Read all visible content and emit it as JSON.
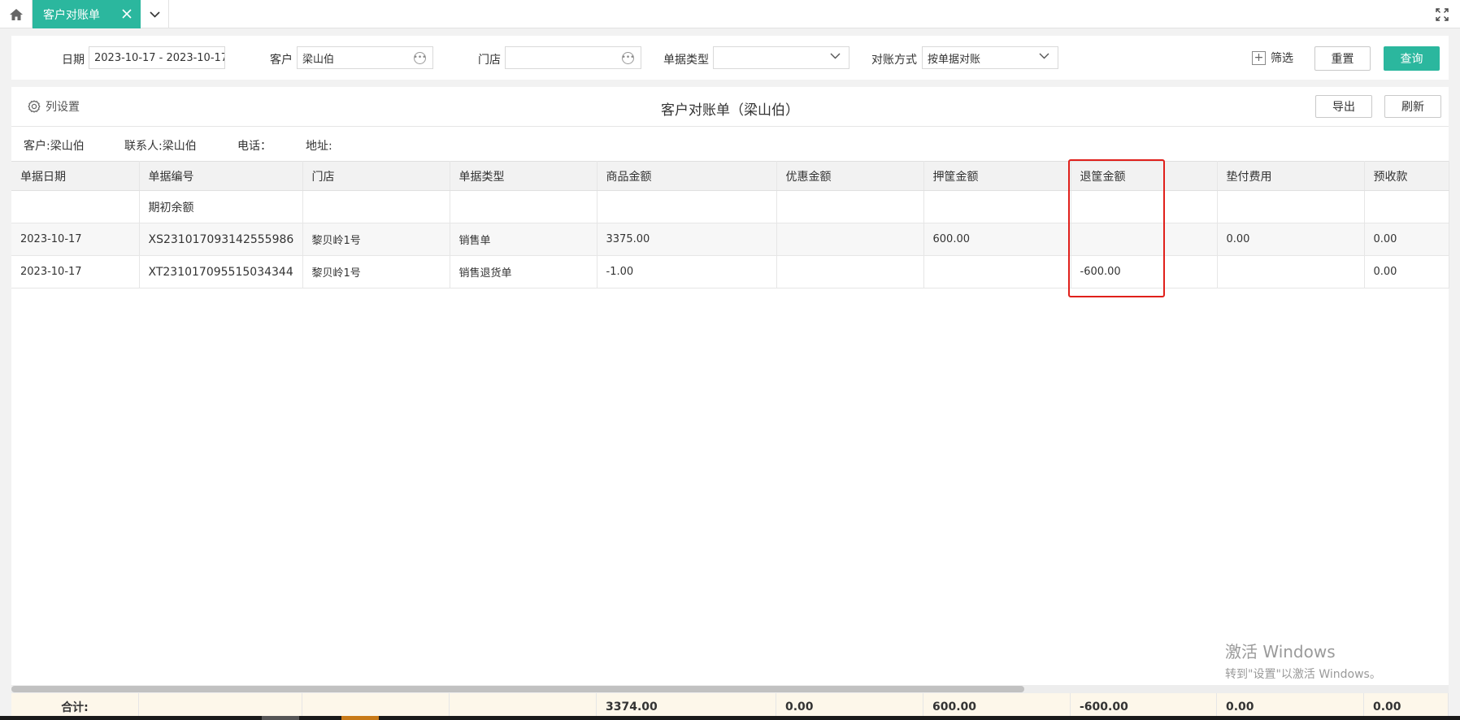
{
  "tabbar": {
    "active_tab": "客户对账单"
  },
  "filters": {
    "date_label": "日期",
    "date_value": "2023-10-17 - 2023-10-17",
    "customer_label": "客户",
    "customer_value": "梁山伯",
    "store_label": "门店",
    "store_value": "",
    "doc_type_label": "单据类型",
    "doc_type_value": "",
    "recon_method_label": "对账方式",
    "recon_method_value": "按单据对账",
    "filter_toggle_label": "筛选",
    "reset_label": "重置",
    "query_label": "查询"
  },
  "report": {
    "column_settings_label": "列设置",
    "title": "客户对账单（梁山伯）",
    "export_label": "导出",
    "refresh_label": "刷新",
    "info": {
      "customer": "客户:梁山伯",
      "contact": "联系人:梁山伯",
      "phone": "电话：",
      "address": "地址:"
    }
  },
  "table": {
    "headers": [
      "单据日期",
      "单据编号",
      "门店",
      "单据类型",
      "商品金额",
      "优惠金额",
      "押筐金额",
      "退筐金额",
      "垫付费用",
      "预收款"
    ],
    "rows": [
      [
        "",
        "期初余额",
        "",
        "",
        "",
        "",
        "",
        "",
        "",
        ""
      ],
      [
        "2023-10-17",
        "XS231017093142555986",
        "黎贝岭1号",
        "销售单",
        "3375.00",
        "",
        "600.00",
        "",
        "0.00",
        "0.00"
      ],
      [
        "2023-10-17",
        "XT231017095515034344",
        "黎贝岭1号",
        "销售退货单",
        "-1.00",
        "",
        "",
        "-600.00",
        "",
        "0.00"
      ]
    ],
    "totals": {
      "label": "合计:",
      "values": [
        "",
        "",
        "",
        "3374.00",
        "0.00",
        "600.00",
        "-600.00",
        "0.00",
        "0.00"
      ]
    }
  },
  "watermark": {
    "line1": "激活 Windows",
    "line2": "转到\"设置\"以激活 Windows。"
  },
  "colors": {
    "accent": "#2bb79e",
    "highlight": "#e0201b",
    "totals_bg": "#fdf7ea"
  }
}
